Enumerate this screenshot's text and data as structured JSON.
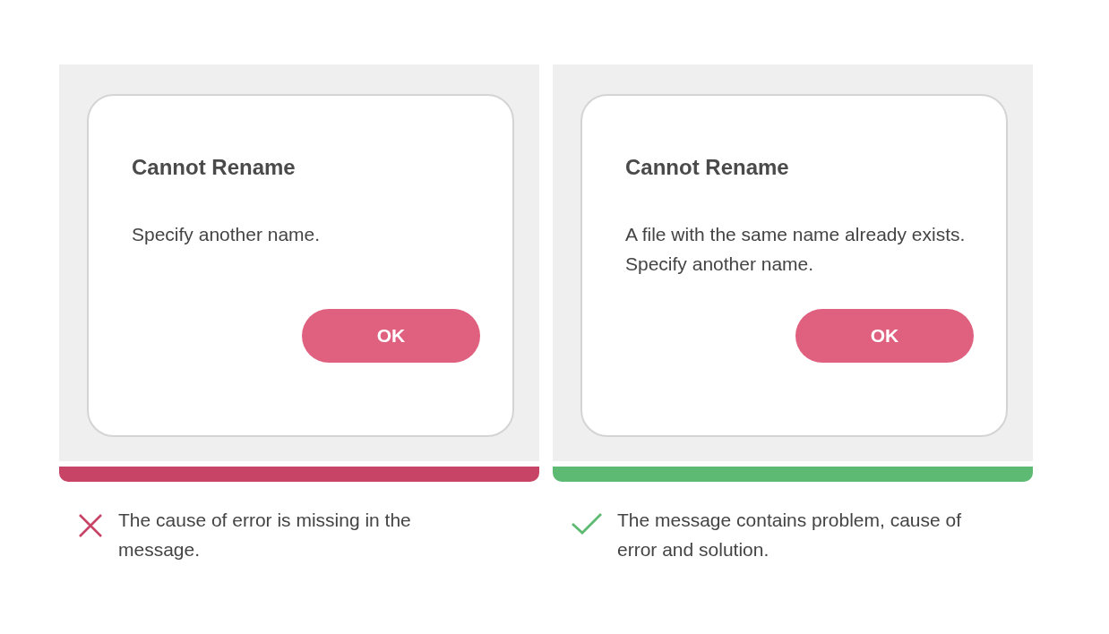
{
  "examples": [
    {
      "kind": "bad",
      "dialog": {
        "title": "Cannot Rename",
        "message": "Specify another name.",
        "button": "OK"
      },
      "caption": "The cause of error is missing in the message."
    },
    {
      "kind": "good",
      "dialog": {
        "title": "Cannot Rename",
        "message": "A file with the same name already exists. Specify another name.",
        "button": "OK"
      },
      "caption": "The message contains problem, cause of error and solution."
    }
  ]
}
